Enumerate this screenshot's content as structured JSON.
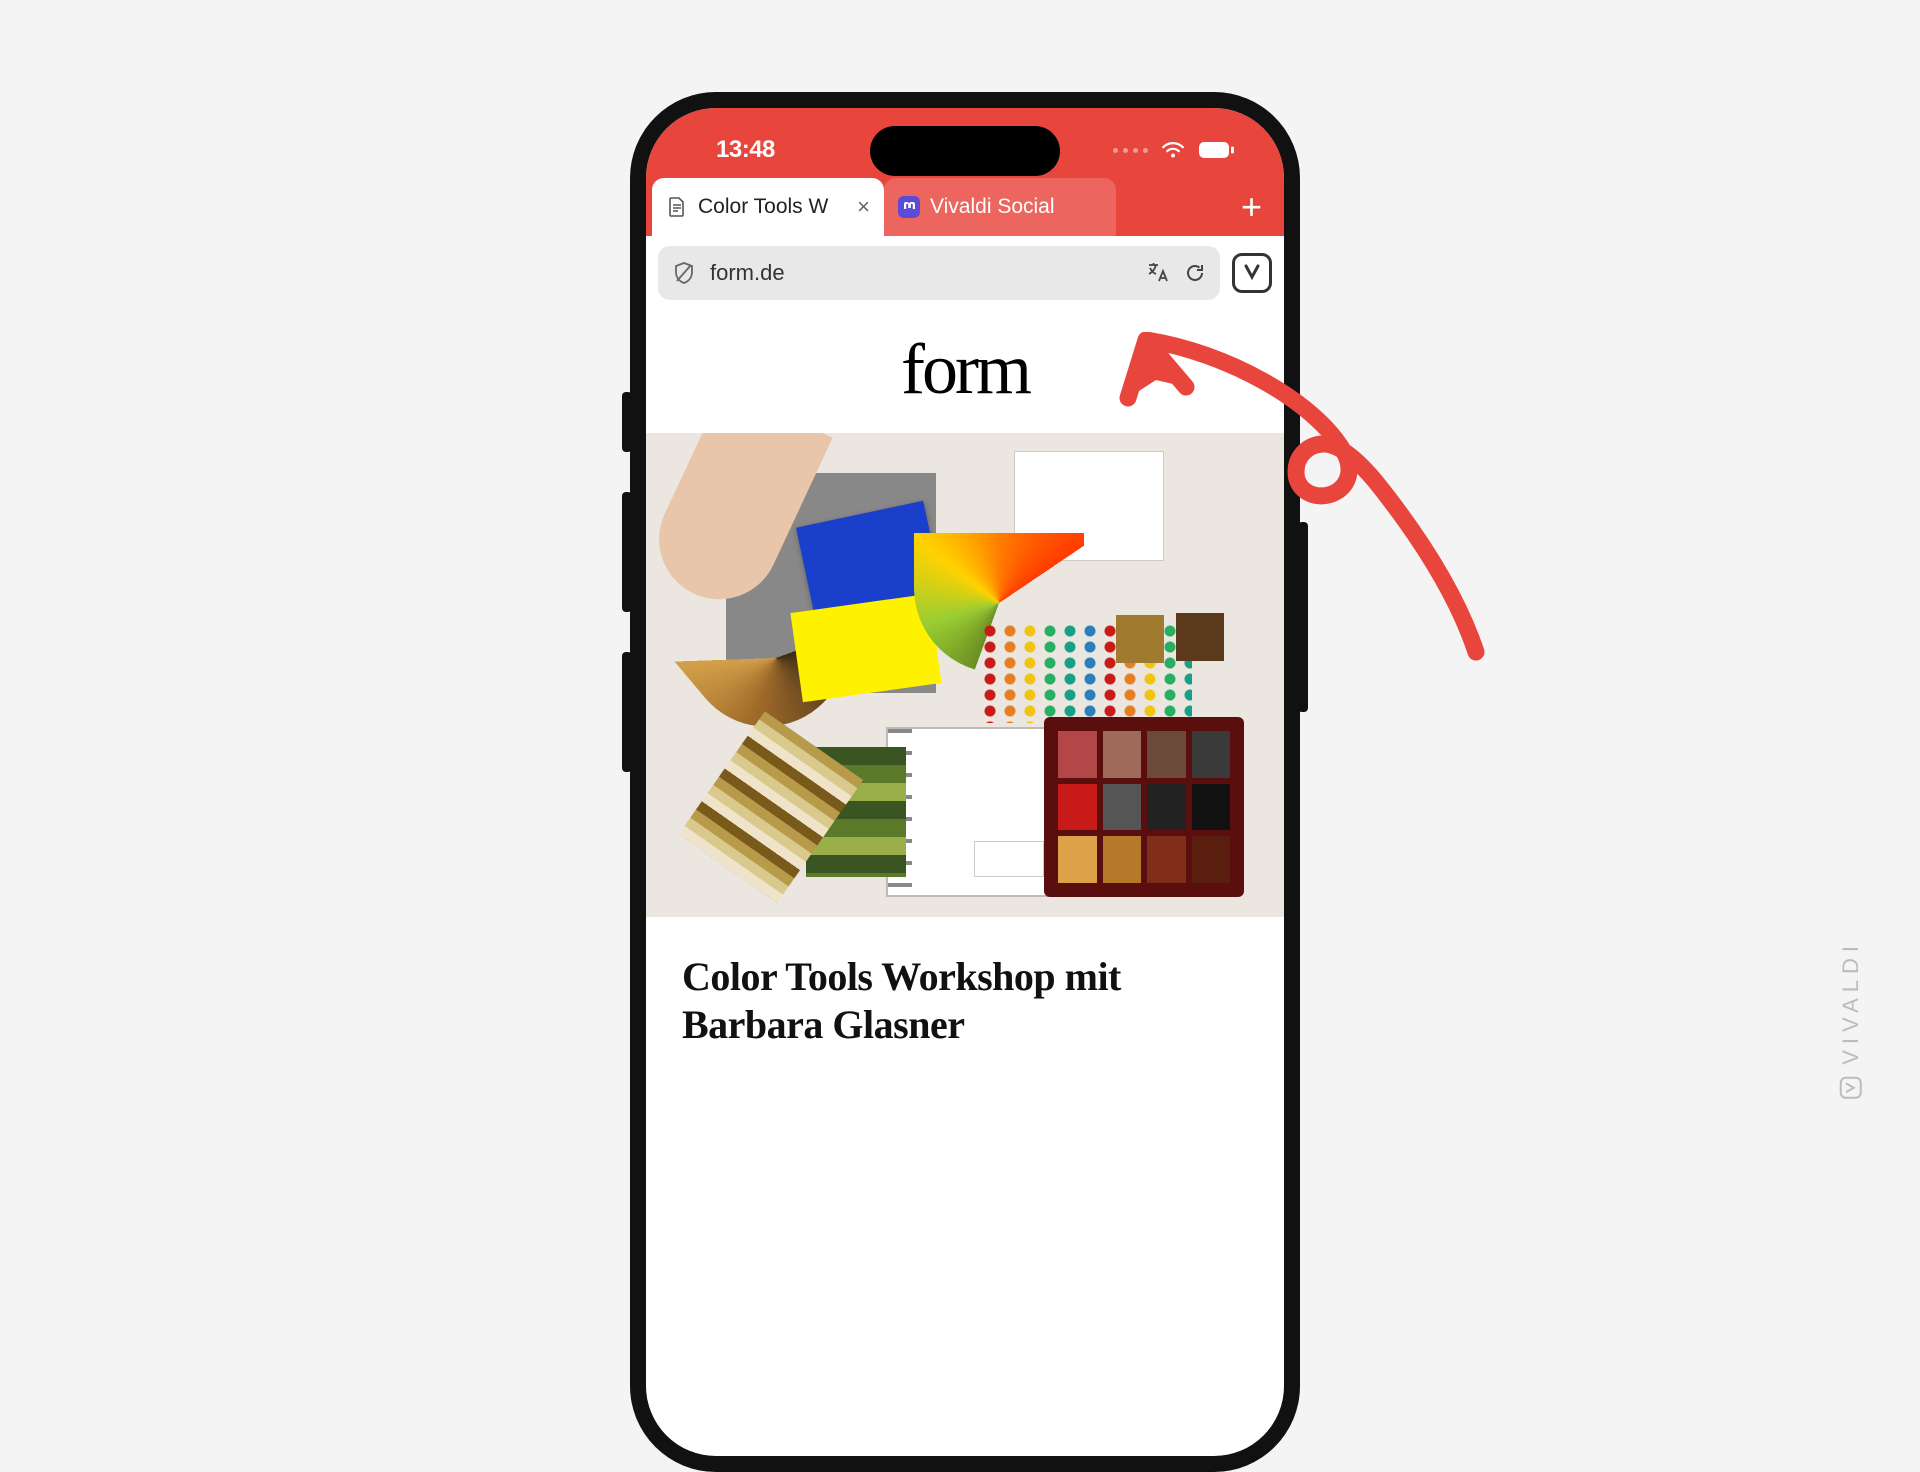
{
  "status_bar": {
    "time": "13:48"
  },
  "tabs": [
    {
      "label": "Color Tools W",
      "favicon": "document-icon",
      "active": true
    },
    {
      "label": "Vivaldi Social",
      "favicon": "mastodon-icon",
      "active": false
    }
  ],
  "address_bar": {
    "url": "form.de"
  },
  "page": {
    "logo_text": "form",
    "article_title": "Color Tools Workshop mit Barbara Glasner"
  },
  "watermark": {
    "text": "VIVALDI"
  },
  "colors": {
    "accent": "#e8453c",
    "annotation_arrow": "#e8453c"
  }
}
